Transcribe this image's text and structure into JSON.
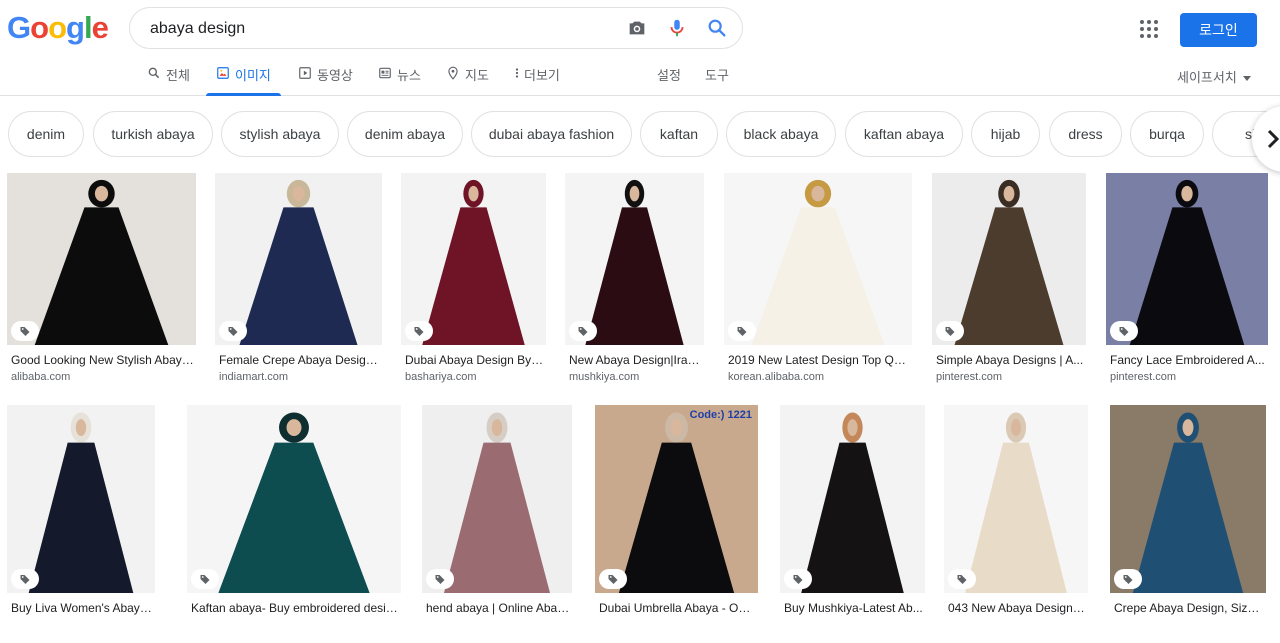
{
  "header": {
    "logo_letters": [
      "G",
      "o",
      "o",
      "g",
      "l",
      "e"
    ],
    "logo_colors": [
      "#4285f4",
      "#ea4335",
      "#fbbc05",
      "#4285f4",
      "#34a853",
      "#ea4335"
    ],
    "search_value": "abaya design",
    "login_label": "로그인"
  },
  "tabs": [
    {
      "label": "전체",
      "icon": "search-icon"
    },
    {
      "label": "이미지",
      "icon": "image-icon",
      "active": true
    },
    {
      "label": "동영상",
      "icon": "play-icon"
    },
    {
      "label": "뉴스",
      "icon": "news-icon"
    },
    {
      "label": "지도",
      "icon": "map-pin-icon"
    },
    {
      "label": "더보기",
      "icon": "more-vert-icon"
    }
  ],
  "settings_label": "설정",
  "tools_label": "도구",
  "safesearch_label": "세이프서치",
  "chips": [
    "denim",
    "turkish abaya",
    "stylish abaya",
    "denim abaya",
    "dubai abaya fashion",
    "kaftan",
    "black abaya",
    "kaftan abaya",
    "hijab",
    "dress",
    "burqa",
    "sim"
  ],
  "colors": {
    "accent": "#1a73e8",
    "border": "#dfe1e5",
    "muted": "#5f6368"
  },
  "results": [
    {
      "title": "Good Looking New Stylish Abaya ...",
      "source": "alibaba.com",
      "bg": "#e4e1dc",
      "dress": "#0c0c0c",
      "head": "#0c0c0c"
    },
    {
      "title": "Female Crepe Abaya Design ...",
      "source": "indiamart.com",
      "bg": "#f1f1f1",
      "dress": "#1e2a52",
      "head": "#c9b79a"
    },
    {
      "title": "Dubai Abaya Design By ...",
      "source": "bashariya.com",
      "bg": "#f3f3f3",
      "dress": "#6e1426",
      "head": "#6e1426"
    },
    {
      "title": "New Abaya Design|Iran...",
      "source": "mushkiya.com",
      "bg": "#f4f4f4",
      "dress": "#2a0c12",
      "head": "#111111"
    },
    {
      "title": "2019 New Latest Design Top Qu...",
      "source": "korean.alibaba.com",
      "bg": "#f6f6f6",
      "dress": "#f5f1e6",
      "head": "#c59a43"
    },
    {
      "title": "Simple Abaya Designs | A...",
      "source": "pinterest.com",
      "bg": "#ececec",
      "dress": "#4b3c2e",
      "head": "#3a2e24"
    },
    {
      "title": "Fancy Lace Embroidered A...",
      "source": "pinterest.com",
      "bg": "#7a7fa6",
      "dress": "#0b0b0f",
      "head": "#0b0b0f"
    },
    {
      "title": "Buy Liva Women's Abaya F...",
      "source": "",
      "bg": "#f2f2f2",
      "dress": "#141a2c",
      "head": "#e6e2d9"
    },
    {
      "title": "Kaftan abaya- Buy embroidered desig...",
      "source": "",
      "bg": "#f5f5f5",
      "dress": "#0d4c4f",
      "head": "#0e2e2f"
    },
    {
      "title": "hend abaya | Online Abay...",
      "source": "",
      "bg": "#efefef",
      "dress": "#9a6b70",
      "head": "#d6cdc5"
    },
    {
      "title": "Dubai Umbrella Abaya - Onli...",
      "source": "",
      "bg": "#c9a98d",
      "dress": "#0c0c0e",
      "head": "#cbb9a5",
      "badge": "Code:) 1221"
    },
    {
      "title": "Buy Mushkiya-Latest Ab...",
      "source": "",
      "bg": "#f3f3f3",
      "dress": "#151214",
      "head": "#c4875a"
    },
    {
      "title": "043 New Abaya Design ...",
      "source": "",
      "bg": "#f6f6f6",
      "dress": "#e8dcc8",
      "head": "#d9c9b5"
    },
    {
      "title": "Crepe Abaya Design, Size : ...",
      "source": "",
      "bg": "#8a7a68",
      "dress": "#1f4f73",
      "head": "#1f4f73"
    }
  ]
}
